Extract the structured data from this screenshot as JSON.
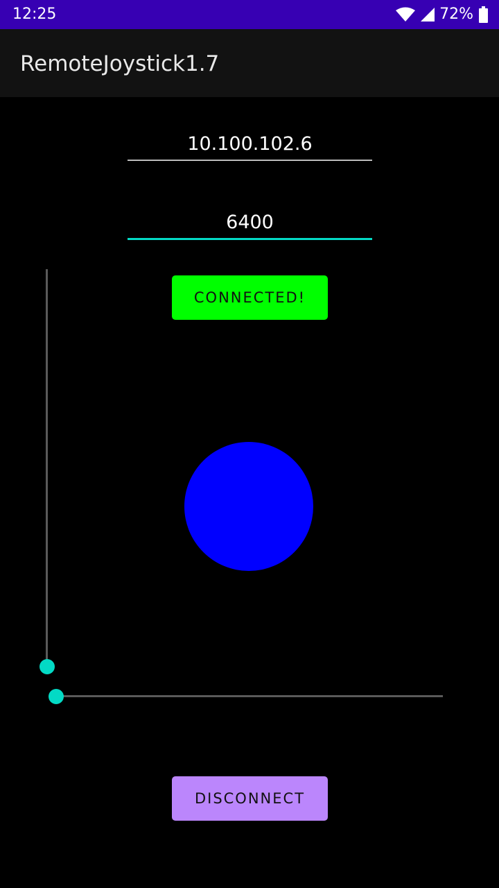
{
  "status_bar": {
    "time": "12:25",
    "battery_percent": "72%",
    "icons": [
      "wifi-icon",
      "cell-signal-icon",
      "battery-icon"
    ],
    "background_color": "#3700b3"
  },
  "app_bar": {
    "title": "RemoteJoystick1.7"
  },
  "connection": {
    "ip_address": "10.100.102.6",
    "port": "6400",
    "status_button_label": "CONNECTED!",
    "status_button_color": "#00ff00"
  },
  "joystick": {
    "knob_color": "#0000ff"
  },
  "sliders": {
    "vertical_value": 0,
    "horizontal_value": 0,
    "accent_color": "#03dac5"
  },
  "disconnect": {
    "label": "DISCONNECT",
    "color": "#bb86fc"
  }
}
